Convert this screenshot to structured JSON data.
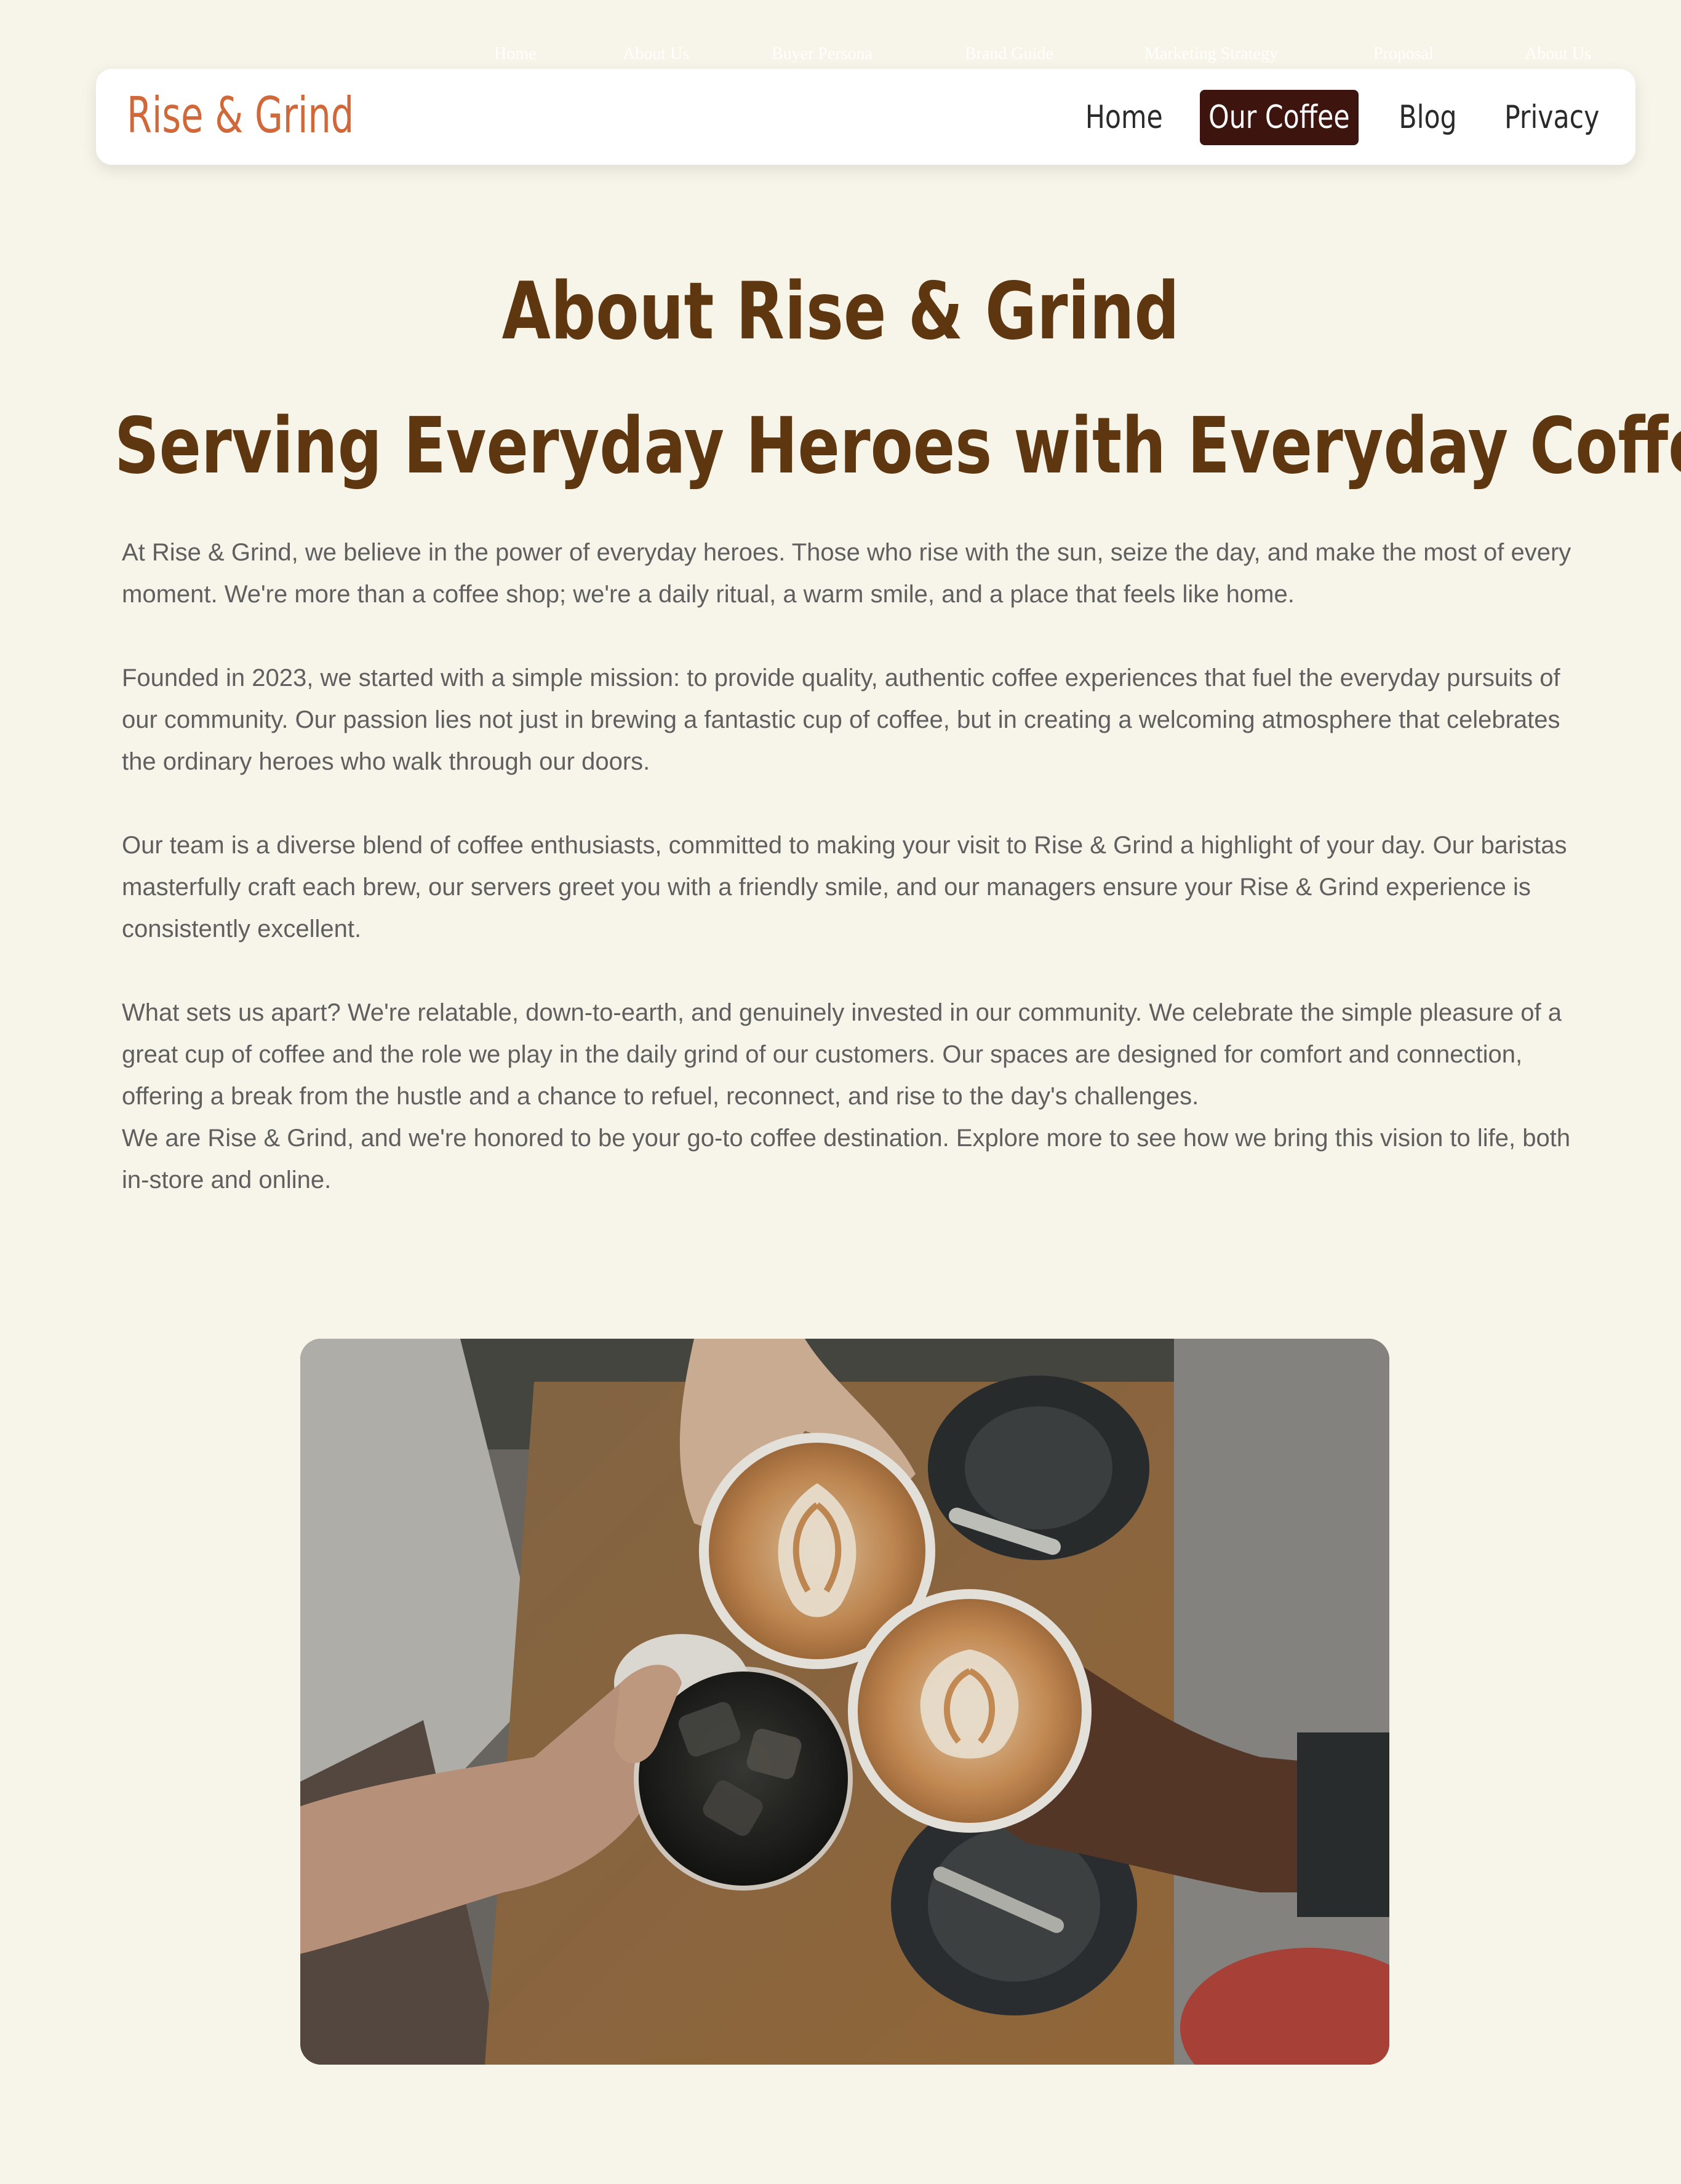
{
  "top_nav": {
    "items": [
      "Home",
      "About Us",
      "Buyer Persona",
      "Brand Guide",
      "Marketing Strategy",
      "Proposal",
      "About Us"
    ]
  },
  "header": {
    "brand": "Rise & Grind",
    "nav": [
      {
        "label": "Home",
        "active": false
      },
      {
        "label": "Our Coffee",
        "active": true
      },
      {
        "label": "Blog",
        "active": false
      },
      {
        "label": "Privacy",
        "active": false
      }
    ]
  },
  "main": {
    "title": "About Rise & Grind",
    "subtitle": "Serving Everyday Heroes with Everyday Coffee",
    "paragraphs": [
      "At Rise & Grind, we believe in the power of everyday heroes. Those who rise with the sun, seize the day, and make the most of every moment. We're more than a coffee shop; we're a daily ritual, a warm smile, and a place that feels like home.",
      "Founded in 2023, we started with a simple mission: to provide quality, authentic coffee experiences that fuel the everyday pursuits of our community. Our passion lies not just in brewing a fantastic cup of coffee, but in creating a welcoming atmosphere that celebrates the ordinary heroes who walk through our doors.",
      "Our team is a diverse blend of coffee enthusiasts, committed to making your visit to Rise & Grind a highlight of your day. Our baristas masterfully craft each brew, our servers greet you with a friendly smile, and our managers ensure your Rise & Grind experience is consistently excellent.",
      "What sets us apart? We're relatable, down-to-earth, and genuinely invested in our community. We celebrate the simple pleasure of a great cup of coffee and the role we play in the daily grind of our customers. Our spaces are designed for comfort and connection, offering a break from the hustle and a chance to refuel, reconnect, and rise to the day's challenges.",
      "We are Rise & Grind, and we're honored to be your go-to coffee destination. Explore more to see how we bring this vision to life, both in-store and online."
    ]
  },
  "colors": {
    "background": "#f7f5e9",
    "brand": "#d0683a",
    "heading": "#5e3710",
    "nav_active_bg": "#3d150e",
    "body_text": "#5f5f5f"
  }
}
